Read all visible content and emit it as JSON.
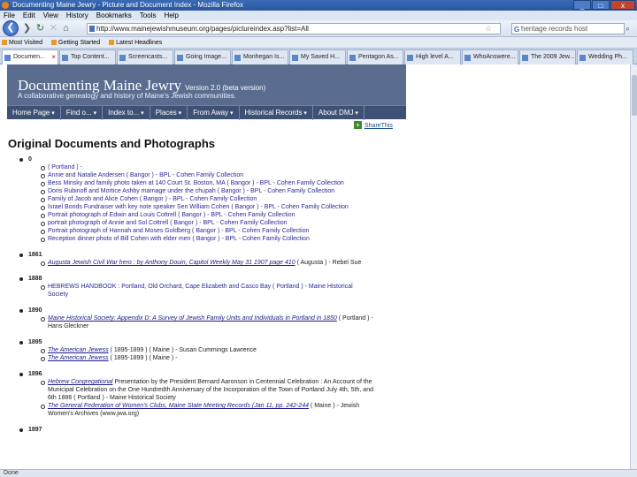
{
  "window": {
    "title": "Documenting Maine Jewry - Picture and Document Index - Mozilla Firefox",
    "controls": [
      "_",
      "□",
      "x"
    ]
  },
  "menu": [
    "File",
    "Edit",
    "View",
    "History",
    "Bookmarks",
    "Tools",
    "Help"
  ],
  "nav": {
    "url": "http://www.mainejewishmuseum.org/pages/pictureindex.asp?list=All",
    "search_value": "heritage records host"
  },
  "bookmarks": [
    "Most Visited",
    "Getting Started",
    "Latest Headlines"
  ],
  "tabs": [
    {
      "label": "Documen...",
      "active": true
    },
    {
      "label": "Top Content...",
      "active": false
    },
    {
      "label": "Screencasts...",
      "active": false
    },
    {
      "label": "Going Image...",
      "active": false
    },
    {
      "label": "Monhegan Is...",
      "active": false
    },
    {
      "label": "My Saved H...",
      "active": false
    },
    {
      "label": "Pentagon As...",
      "active": false
    },
    {
      "label": "High level A...",
      "active": false
    },
    {
      "label": "WhoAnswere...",
      "active": false
    },
    {
      "label": "The 2009 Jew...",
      "active": false
    },
    {
      "label": "Wedding Ph...",
      "active": false
    }
  ],
  "site": {
    "title": "Documenting Maine Jewry",
    "version": "Version 2.0 (beta version)",
    "subtitle": "A collaborative genealogy and history of Maine's Jewish communities.",
    "nav": [
      "Home Page",
      "Find o...",
      "Index to...",
      "Places",
      "From Away",
      "Historical Records",
      "About DMJ"
    ],
    "share": "ShareThis"
  },
  "page_heading": "Original Documents and Photographs",
  "years": [
    {
      "year": "0",
      "items": [
        {
          "text": "( Portland ) -"
        },
        {
          "text": "Annie and Natalie Andersen ( Bangor ) - BPL - Cohen Family Collection"
        },
        {
          "text": "Bess Minsky and family photo taken at 140 Court St. Boston, MA ( Bangor ) - BPL - Cohen Family Collection"
        },
        {
          "text": "Doris Rubinoff and Mortice Ashby marriage under the chupah ( Bangor ) - BPL - Cohen Family Collection"
        },
        {
          "text": "Family of Jacob and Alice Cohen ( Bangor ) - BPL - Cohen Family Collection"
        },
        {
          "text": "Israel Bonds Fundraiser with key note speaker Sen William Cohen ( Bangor ) - BPL - Cohen Family Collection"
        },
        {
          "text": "Portrait photograph of Edwin and Louis Cottrell ( Bangor ) - BPL - Cohen Family Collection"
        },
        {
          "text": "portrait photograph of Annie and Sol Cottrell ( Bangor ) - BPL - Cohen Family Collection"
        },
        {
          "text": "Portrait photograph of Hannah and Moses Goldberg ( Bangor ) - BPL - Cohen Family Collection"
        },
        {
          "text": "Reception dinner photo of Bill Cohen with elder men ( Bangor ) - BPL - Cohen Family Collection"
        }
      ]
    },
    {
      "year": "1861",
      "items": [
        {
          "link": "Augusta Jewish Civil War hero : by Anthony Douin, Capitol Weekly May 31 1907 page 410",
          "text": " ( Augusta ) - Rebel Sue"
        }
      ]
    },
    {
      "year": "1888",
      "items": [
        {
          "text": "HEBREWS HANDBOOK : Portland, Old Orchard, Cape Elizabeth and Casco Bay ( Portland ) - Maine Historical Society"
        }
      ]
    },
    {
      "year": "1890",
      "items": [
        {
          "link": "Maine Historical Society: Appendix D: A Survey of Jewish Family Units and Individuals in Portland in 1850",
          "text": " ( Portland ) - Hans Gleckner"
        }
      ]
    },
    {
      "year": "1895",
      "items": [
        {
          "link": "The American Jewess",
          "text": " ( 1895-1899 ) ( Maine ) - Susan Cummings Lawrence"
        },
        {
          "link": "The American Jewess",
          "text": " ( 1895-1899 ) ( Maine ) -"
        }
      ]
    },
    {
      "year": "1896",
      "items": [
        {
          "link": "Hebrew Congregational",
          "text": " Presentation by the President Bernard Aaronson in Centennial Celebration : An Account of the Municipal Celebration on the One Hundredth Anniversary of the Incorporation of the Town of Portland July 4th, 5th, and 6th 1886 ( Portland ) - Maine Historical Society"
        },
        {
          "link": "The General Federation of Women's Clubs, Maine State Meeting Records (Jan 11, pp. 242-244",
          "text": " ( Maine ) - Jewish Women's Archives (www.jwa.org)"
        }
      ]
    },
    {
      "year": "1897",
      "items": []
    }
  ],
  "status": "Done"
}
